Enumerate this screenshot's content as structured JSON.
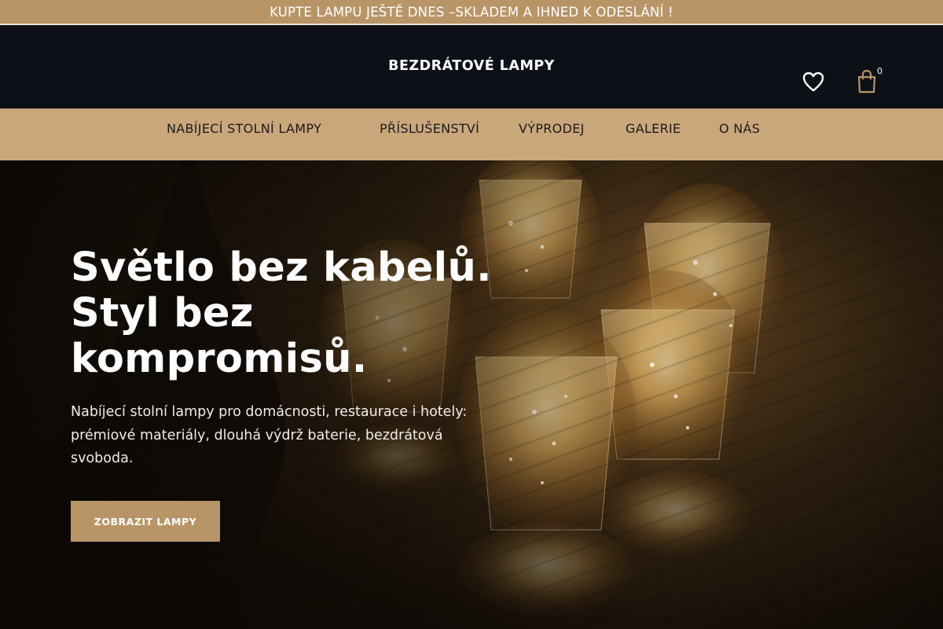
{
  "promo": {
    "text": "KUPTE LAMPU JEŠTĚ DNES –SKLADEM A IHNED K ODESLÁNÍ !"
  },
  "header": {
    "brand": "BEZDRÁTOVÉ LAMPY",
    "cart_count": "0",
    "wishlist_icon": "heart-icon",
    "cart_icon": "shopping-bag-icon"
  },
  "nav": {
    "items": [
      {
        "label": "NABÍJECÍ STOLNÍ LAMPY"
      },
      {
        "label": "PŘÍSLUŠENSTVÍ"
      },
      {
        "label": "VÝPRODEJ"
      },
      {
        "label": "GALERIE"
      },
      {
        "label": "O NÁS"
      }
    ]
  },
  "hero": {
    "title": "Světlo bez kabelů. Styl bez kompromisů.",
    "subtitle": "Nabíjecí stolní lampy pro domácnosti, restaurace i hotely: prémiové materiály, dlouhá výdrž baterie, bezdrátová svoboda.",
    "cta_label": "ZOBRAZIT LAMPY"
  },
  "colors": {
    "accent": "#b89567",
    "nav_bg": "#caa77b",
    "header_bg": "#0d1117"
  }
}
